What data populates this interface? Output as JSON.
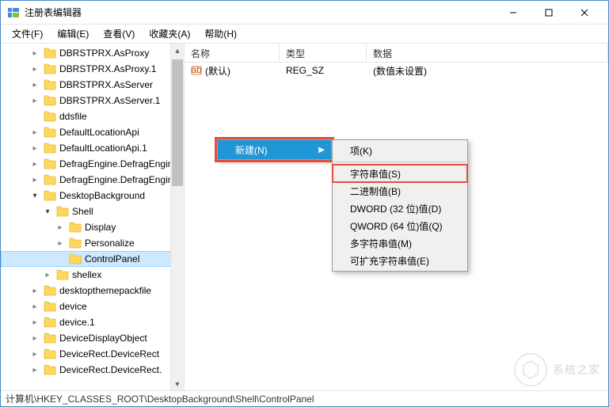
{
  "window": {
    "title": "注册表编辑器"
  },
  "menu": {
    "file": "文件(F)",
    "edit": "编辑(E)",
    "view": "查看(V)",
    "favorites": "收藏夹(A)",
    "help": "帮助(H)"
  },
  "tree": {
    "items": [
      {
        "label": "DBRSTPRX.AsProxy",
        "indent": 2,
        "chev": "collapsed"
      },
      {
        "label": "DBRSTPRX.AsProxy.1",
        "indent": 2,
        "chev": "collapsed"
      },
      {
        "label": "DBRSTPRX.AsServer",
        "indent": 2,
        "chev": "collapsed"
      },
      {
        "label": "DBRSTPRX.AsServer.1",
        "indent": 2,
        "chev": "collapsed"
      },
      {
        "label": "ddsfile",
        "indent": 2,
        "chev": "none"
      },
      {
        "label": "DefaultLocationApi",
        "indent": 2,
        "chev": "collapsed"
      },
      {
        "label": "DefaultLocationApi.1",
        "indent": 2,
        "chev": "collapsed"
      },
      {
        "label": "DefragEngine.DefragEngine",
        "indent": 2,
        "chev": "collapsed"
      },
      {
        "label": "DefragEngine.DefragEngine",
        "indent": 2,
        "chev": "collapsed"
      },
      {
        "label": "DesktopBackground",
        "indent": 2,
        "chev": "expanded"
      },
      {
        "label": "Shell",
        "indent": 3,
        "chev": "expanded"
      },
      {
        "label": "Display",
        "indent": 4,
        "chev": "collapsed"
      },
      {
        "label": "Personalize",
        "indent": 4,
        "chev": "collapsed"
      },
      {
        "label": "ControlPanel",
        "indent": 4,
        "chev": "none",
        "selected": true,
        "highlight": true
      },
      {
        "label": "shellex",
        "indent": 3,
        "chev": "collapsed"
      },
      {
        "label": "desktopthemepackfile",
        "indent": 2,
        "chev": "collapsed"
      },
      {
        "label": "device",
        "indent": 2,
        "chev": "collapsed"
      },
      {
        "label": "device.1",
        "indent": 2,
        "chev": "collapsed"
      },
      {
        "label": "DeviceDisplayObject",
        "indent": 2,
        "chev": "collapsed"
      },
      {
        "label": "DeviceRect.DeviceRect",
        "indent": 2,
        "chev": "collapsed"
      },
      {
        "label": "DeviceRect.DeviceRect.",
        "indent": 2,
        "chev": "collapsed"
      }
    ]
  },
  "columns": {
    "name": "名称",
    "type": "类型",
    "data": "数据"
  },
  "row": {
    "default_name": "(默认)",
    "default_type": "REG_SZ",
    "default_data": "(数值未设置)"
  },
  "ctx": {
    "new": "新建(N)",
    "key": "项(K)",
    "string": "字符串值(S)",
    "binary": "二进制值(B)",
    "dword": "DWORD (32 位)值(D)",
    "qword": "QWORD (64 位)值(Q)",
    "multi": "多字符串值(M)",
    "expand": "可扩充字符串值(E)"
  },
  "status": "计算机\\HKEY_CLASSES_ROOT\\DesktopBackground\\Shell\\ControlPanel",
  "watermark": "系统之家"
}
